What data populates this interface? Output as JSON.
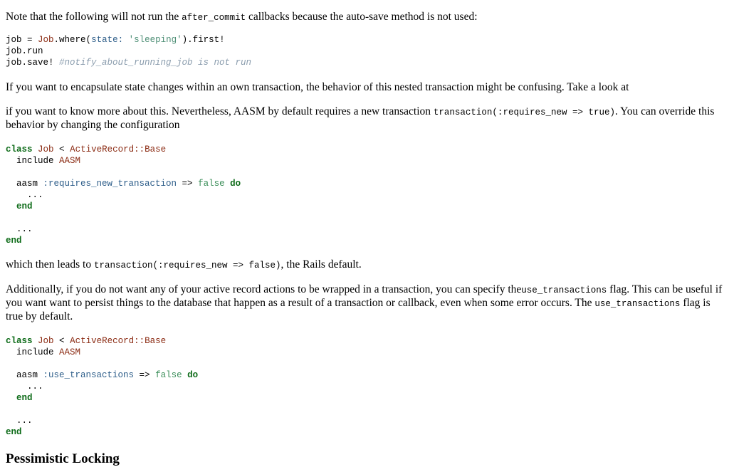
{
  "para_after_commit": {
    "before": "Note that the following will not run the ",
    "code": "after_commit",
    "after": " callbacks because the auto-save method is not used:"
  },
  "code_block_1": {
    "l1_var": "job",
    "l1_eq": " = ",
    "l1_cls": "Job",
    "l1_where": ".where(",
    "l1_sym": "state:",
    "l1_sp": " ",
    "l1_str": "'sleeping'",
    "l1_end": ").first!",
    "l2": "job.run",
    "l3_code": "job.save! ",
    "l3_comment": "#notify_about_running_job is not run"
  },
  "para_encapsulate": "If you want to encapsulate state changes within an own transaction, the behavior of this nested transaction might be confusing. Take a look at",
  "para_requires_new": {
    "before": "if you want to know more about this. Nevertheless, AASM by default requires a new transaction ",
    "code": "transaction(:requires_new => true)",
    "after": ". You can override this behavior by changing the configuration"
  },
  "code_block_2": {
    "class_kw": "class",
    "class_name": "Job",
    "lt": " < ",
    "base": "ActiveRecord::Base",
    "include": "  include ",
    "aasm_mod": "AASM",
    "aasm": "  aasm ",
    "option": ":requires_new_transaction",
    "arrow": " => ",
    "false_lit": "false",
    "do_kw": "do",
    "dots_inner": "    ...",
    "end_inner": "end",
    "dots_outer": "  ...",
    "end_outer": "end"
  },
  "para_rails_default": {
    "before": "which then leads to ",
    "code": "transaction(:requires_new => false)",
    "after": ", the Rails default."
  },
  "para_use_transactions": {
    "before": "Additionally, if you do not want any of your active record actions to be wrapped in a transaction, you can specify the",
    "code1": "use_transactions",
    "middle": " flag. This can be useful if you want want to persist things to the database that happen as a result of a transaction or callback, even when some error occurs. The ",
    "code2": "use_transactions",
    "after": " flag is true by default."
  },
  "code_block_3": {
    "class_kw": "class",
    "class_name": "Job",
    "lt": " < ",
    "base": "ActiveRecord::Base",
    "include": "  include ",
    "aasm_mod": "AASM",
    "aasm": "  aasm ",
    "option": ":use_transactions",
    "arrow": " => ",
    "false_lit": "false",
    "do_kw": "do",
    "dots_inner": "    ...",
    "end_inner": "end",
    "dots_outer": "  ...",
    "end_outer": "end"
  },
  "heading_pessimistic": "Pessimistic Locking"
}
